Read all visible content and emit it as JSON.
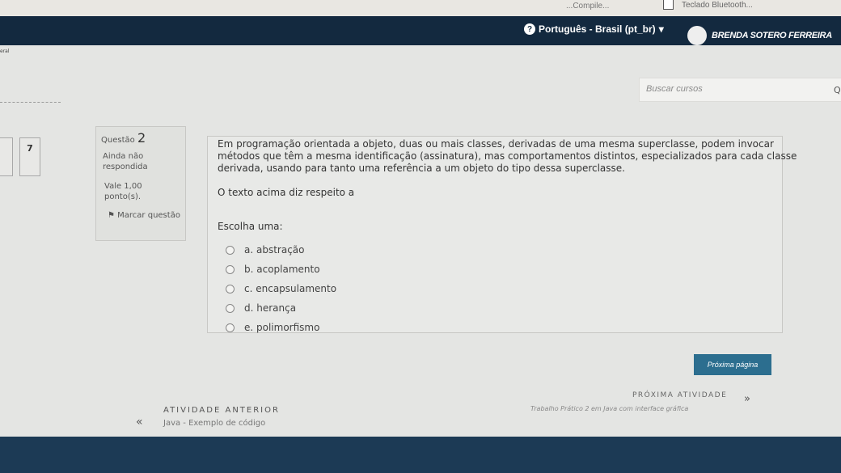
{
  "taskbar": {
    "partial_text": "...Compile...",
    "bluetooth_label": "Teclado Bluetooth..."
  },
  "nav": {
    "language": "Português - Brasil (pt_br)",
    "user_name": "BRENDA SOTERO FERREIRA"
  },
  "left_edge_text": "eral",
  "search": {
    "placeholder": "Buscar cursos"
  },
  "question_nav": [
    {
      "number": ""
    },
    {
      "number": "7"
    }
  ],
  "question_info": {
    "label": "Questão",
    "number": "2",
    "status": "Ainda não respondida",
    "grade": "Vale 1,00 ponto(s).",
    "flag_label": "Marcar questão"
  },
  "question": {
    "text": "Em programação orientada a objeto, duas ou mais classes, derivadas de uma mesma superclasse, podem invocar métodos que têm a mesma identificação (assinatura), mas comportamentos distintos, especializados para cada classe derivada, usando para tanto uma referência a um objeto do tipo dessa superclasse.",
    "subtext": "O texto acima diz respeito a",
    "prompt": "Escolha uma:",
    "options": [
      {
        "label": "a. abstração"
      },
      {
        "label": "b. acoplamento"
      },
      {
        "label": "c. encapsulamento"
      },
      {
        "label": "d. herança"
      },
      {
        "label": "e. polimorfismo"
      }
    ]
  },
  "buttons": {
    "next_page": "Próxima página"
  },
  "activity_nav": {
    "prev_label": "ATIVIDADE ANTERIOR",
    "prev_link": "Java - Exemplo de código",
    "next_label": "PRÓXIMA ATIVIDADE",
    "next_link": "Trabalho Prático 2 em Java com interface gráfica",
    "prev_arrow": "«",
    "next_arrow": "»"
  }
}
